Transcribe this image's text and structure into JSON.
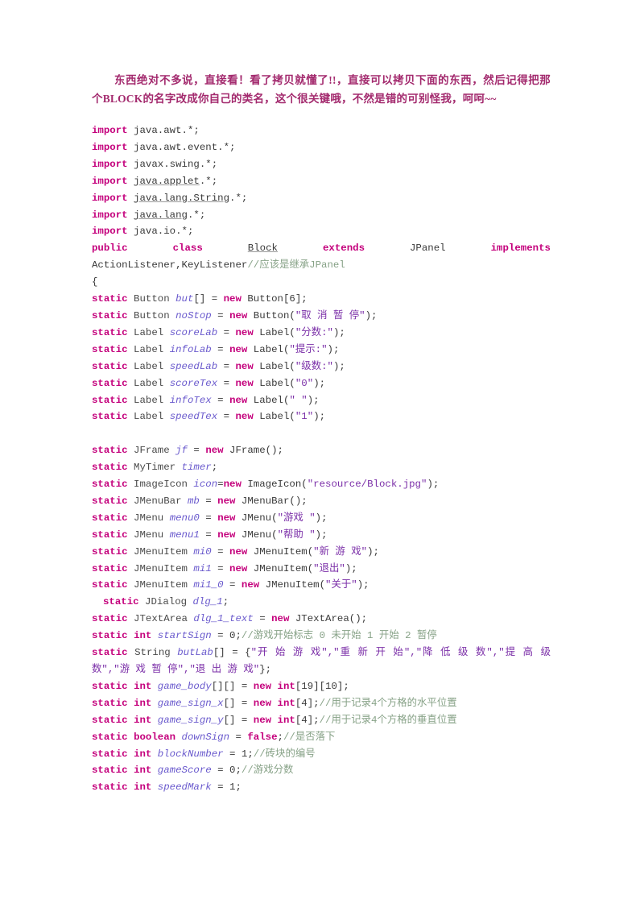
{
  "intro": {
    "line1": "东西绝对不多说，直接看！看了拷贝就懂了!!，直接可以拷贝下面的东西，然后记得把那个BLOCK的名字改成你自己的类名，这个很关键哦，不然是错的可别怪我，呵呵~~"
  },
  "code": {
    "imports": [
      {
        "kw": "import",
        "rest": " java.awt.*;",
        "underline": false
      },
      {
        "kw": "import",
        "rest": " java.awt.event.*;",
        "underline": false
      },
      {
        "kw": "import",
        "rest": " javax.swing.*;",
        "underline": false
      },
      {
        "kw": "import",
        "pre": " ",
        "path": "java.applet",
        "post": ".*;",
        "underline": true
      },
      {
        "kw": "import",
        "pre": " ",
        "path": "java.lang.String",
        "post": ".*;",
        "underline": true
      },
      {
        "kw": "import",
        "pre": " ",
        "path": "java.lang",
        "post": ".*;",
        "underline": true
      },
      {
        "kw": "import",
        "rest": " java.io.*;",
        "underline": false
      }
    ],
    "class_decl": {
      "public": "public",
      "class": "class",
      "name": "Block",
      "extends": "extends",
      "super": "JPanel",
      "implements": "implements"
    },
    "interfaces": "ActionListener,KeyListener",
    "interfaces_comment": "//应该是继承JPanel",
    "open_brace": "{",
    "fields": [
      {
        "kw": "static",
        "type": " Button ",
        "var": "but",
        "mid": "[] = ",
        "kw2": "new",
        "tail": " Button[6];"
      },
      {
        "kw": "static",
        "type": " Button ",
        "var": "noStop",
        "mid": " = ",
        "kw2": "new",
        "tail": " Button(",
        "str": "\"取 消 暂 停\"",
        "end": ");"
      },
      {
        "kw": "static",
        "type": " Label ",
        "var": "scoreLab",
        "mid": " = ",
        "kw2": "new",
        "tail": " Label(",
        "str": "\"分数:\"",
        "end": ");"
      },
      {
        "kw": "static",
        "type": " Label ",
        "var": "infoLab",
        "mid": " = ",
        "kw2": "new",
        "tail": " Label(",
        "str": "\"提示:\"",
        "end": ");"
      },
      {
        "kw": "static",
        "type": " Label ",
        "var": "speedLab",
        "mid": " = ",
        "kw2": "new",
        "tail": " Label(",
        "str": "\"级数:\"",
        "end": ");"
      },
      {
        "kw": "static",
        "type": " Label ",
        "var": "scoreTex",
        "mid": " = ",
        "kw2": "new",
        "tail": " Label(",
        "str": "\"0\"",
        "end": ");"
      },
      {
        "kw": "static",
        "type": " Label ",
        "var": "infoTex",
        "mid": " = ",
        "kw2": "new",
        "tail": " Label(",
        "str": "\" \"",
        "end": ");"
      },
      {
        "kw": "static",
        "type": " Label ",
        "var": "speedTex",
        "mid": " = ",
        "kw2": "new",
        "tail": " Label(",
        "str": "\"1\"",
        "end": ");"
      }
    ],
    "fields2": [
      {
        "kw": "static",
        "type": " JFrame ",
        "var": "jf",
        "mid": " = ",
        "kw2": "new",
        "tail": " JFrame();"
      },
      {
        "kw": "static",
        "type": " MyTimer ",
        "var": "timer",
        "mid": ";",
        "kw2": "",
        "tail": ""
      },
      {
        "kw": "static",
        "type": " ImageIcon ",
        "var": "icon",
        "mid": "=",
        "kw2": "new",
        "tail": " ImageIcon(",
        "str": "\"resource/Block.jpg\"",
        "end": ");"
      },
      {
        "kw": "static",
        "type": " JMenuBar ",
        "var": "mb",
        "mid": " = ",
        "kw2": "new",
        "tail": " JMenuBar();"
      },
      {
        "kw": "static",
        "type": " JMenu ",
        "var": "menu0",
        "mid": " = ",
        "kw2": "new",
        "tail": " JMenu(",
        "str": "\"游戏 \"",
        "end": ");"
      },
      {
        "kw": "static",
        "type": " JMenu ",
        "var": "menu1",
        "mid": " = ",
        "kw2": "new",
        "tail": " JMenu(",
        "str": "\"帮助 \"",
        "end": ");"
      },
      {
        "kw": "static",
        "type": " JMenuItem ",
        "var": "mi0",
        "mid": " = ",
        "kw2": "new",
        "tail": " JMenuItem(",
        "str": "\"新 游 戏\"",
        "end": ");"
      },
      {
        "kw": "static",
        "type": " JMenuItem ",
        "var": "mi1",
        "mid": " = ",
        "kw2": "new",
        "tail": " JMenuItem(",
        "str": "\"退出\"",
        "end": ");"
      },
      {
        "kw": "static",
        "type": " JMenuItem ",
        "var": "mi1_0",
        "mid": " = ",
        "kw2": "new",
        "tail": " JMenuItem(",
        "str": "\"关于\"",
        "end": ");"
      }
    ],
    "dialog_line": {
      "kw": "static",
      "type": " JDialog ",
      "var": "dlg_1",
      "mid": ";"
    },
    "textarea_line": {
      "kw": "static",
      "type": " JTextArea ",
      "var": "dlg_1_text",
      "mid": " = ",
      "kw2": "new",
      "tail": " JTextArea();"
    },
    "startsign_line": {
      "kw": "static",
      "kw_type": "int",
      "var": " startSign",
      "mid": " = ",
      "num": "0",
      "semi": ";",
      "comment": "//游戏开始标志 0 未开始 1 开始 2 暂停"
    },
    "butlab_line": {
      "kw": "static",
      "type": " String ",
      "var": "butLab",
      "mid": "[] = {",
      "strings": "\"开 始 游 戏\",\"重 新 开 始\",\"降 低 级 数\",\"提 高 级 数\",\"游 戏 暂 停\",\"退 出 游 戏\"",
      "end": "};"
    },
    "arrays": [
      {
        "kw": "static",
        "kw_type": "int",
        "var": " game_body",
        "mid": "[][] = ",
        "kw2": "new",
        "kw_type2": "int",
        "tail": "[19][10];",
        "comment": ""
      },
      {
        "kw": "static",
        "kw_type": "int",
        "var": " game_sign_x",
        "mid": "[] = ",
        "kw2": "new",
        "kw_type2": "int",
        "tail": "[4];",
        "comment": "//用于记录4个方格的水平位置"
      },
      {
        "kw": "static",
        "kw_type": "int",
        "var": " game_sign_y",
        "mid": "[] = ",
        "kw2": "new",
        "kw_type2": "int",
        "tail": "[4];",
        "comment": "//用于记录4个方格的垂直位置"
      }
    ],
    "scalars": [
      {
        "kw": "static",
        "kw_type": "boolean",
        "var": " downSign",
        "mid": " = ",
        "kw_val": "false",
        "semi": ";",
        "comment": "//是否落下"
      },
      {
        "kw": "static",
        "kw_type": "int",
        "var": " blockNumber",
        "mid": " = ",
        "num": "1",
        "semi": ";",
        "comment": "//砖块的编号"
      },
      {
        "kw": "static",
        "kw_type": "int",
        "var": " gameScore",
        "mid": " = ",
        "num": "0",
        "semi": ";",
        "comment": "//游戏分数"
      },
      {
        "kw": "static",
        "kw_type": "int",
        "var": " speedMark",
        "mid": " = ",
        "num": "1",
        "semi": ";",
        "comment": ""
      }
    ]
  }
}
